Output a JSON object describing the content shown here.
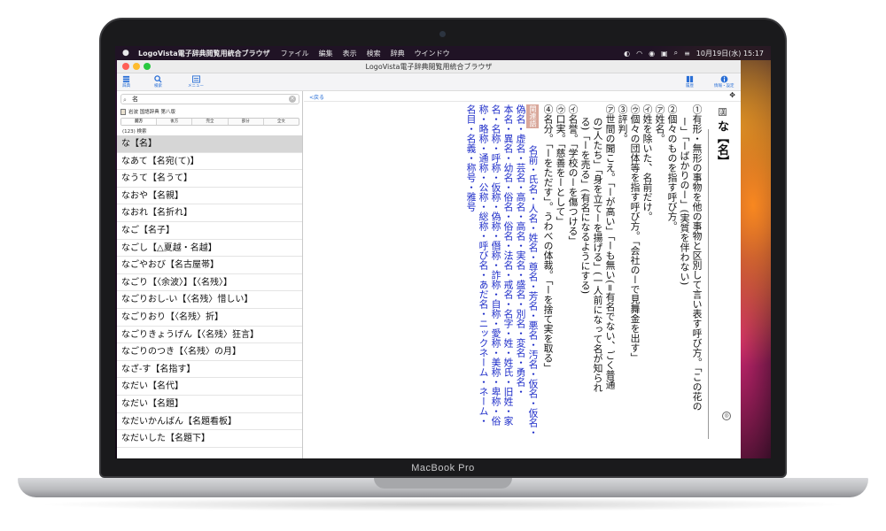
{
  "device": {
    "label": "MacBook Pro"
  },
  "menubar": {
    "app_name": "LogoVista電子辞典閲覧用統合ブラウザ",
    "items": [
      "ファイル",
      "編集",
      "表示",
      "検索",
      "辞典",
      "ウインドウ"
    ],
    "clock": "10月19日(水) 15:17"
  },
  "window": {
    "title": "LogoVista電子辞典閲覧用統合ブラウザ",
    "toolbar": {
      "dictionaries_label": "辞典",
      "search_label": "検索",
      "menu_label": "メニュー",
      "history_label": "履歴",
      "info_label": "情報・設定"
    }
  },
  "sidebar": {
    "search_value": "名",
    "dictionary_name": "岩波 国語辞典 第八版",
    "modes": [
      "前方",
      "後方",
      "完全",
      "部分",
      "全文"
    ],
    "active_mode": "前方",
    "result_count": "(123) 検索",
    "results": [
      "な【名】",
      "なあて【名宛(て)】",
      "なうて【名うて】",
      "なおや【名親】",
      "なおれ【名折れ】",
      "なご【名子】",
      "なごし【△夏越・名越】",
      "なごやおび【名古屋帯】",
      "なごり【〈余波〉】【〈名残〉】",
      "なごりおし-い【〈名残〉惜しい】",
      "なごりおり【〈名残〉折】",
      "なごりきょうげん【〈名残〉狂言】",
      "なごりのつき【〈名残〉の月】",
      "なざ-す【名指す】",
      "なだい【名代】",
      "なだい【名題】",
      "なだいかんばん【名題看板】",
      "なだいした【名題下】"
    ]
  },
  "main": {
    "back_label": "<戻る",
    "entry": {
      "headword": "な【名】",
      "lines": [
        "①有形・無形の事物を他の事物と区別して言い表す呼び方。「この花の",
        "ー」「ーばかりのー」(実質を伴わない)",
        "②個々のものを指す呼び方。",
        "㋐姓名。",
        "㋑姓を除いた、名前だけ。",
        "㋒個々の団体等を指す呼び方。「会社のーで見舞金を出す」",
        "③評判。",
        "㋐世間の聞こえ。「ーが高い」「ーも無い(=有名でない、ごく普通",
        "の)人たち」「身を立てーを揚げる」(一人前になって名が知られ",
        "る)「ーを売る」(有名になるようにする)",
        "㋑名誉。「学校のーを傷つける」",
        "㋒口実。「慈善をーとして」",
        "④名分。「ーをただす」。うわべの体裁。「ーを捨て実を取る」"
      ],
      "related_tag": "関連語",
      "related_lines": [
        "名前・氏名・人名・姓名・尊名・芳名・悪名・汚名・仮名・仮名・",
        "偽名・虚名・芸名・高名・高名・実名・盛名・別名・変名・勇名・",
        "本名・異名・幼名・俗名・俗名・法名・戒名・名字・姓・姓氏・旧姓・家",
        "名・名称・呼称・仮称・偽称・僭称・詐称・自称・愛称・美称・卑称・俗",
        "称・略称・通称・公称・総称・呼び名・あだ名・ニックネーム・ネーム・",
        "名目・名義・称号・雅号"
      ]
    }
  }
}
